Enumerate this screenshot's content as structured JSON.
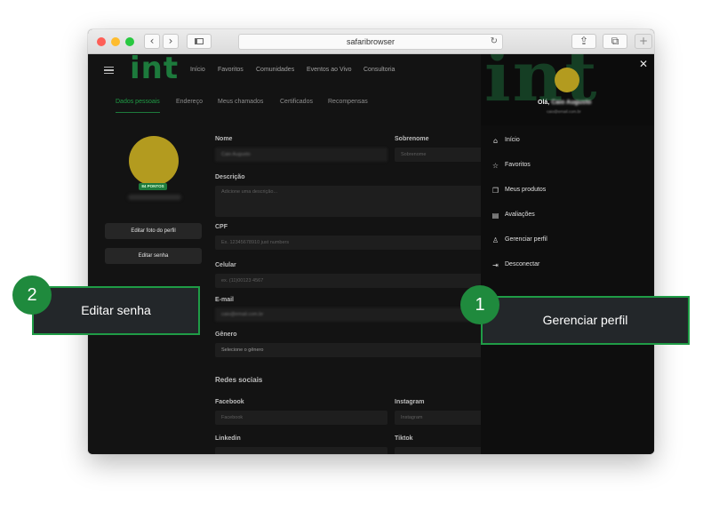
{
  "browser": {
    "url": "safaribrowser",
    "reload_icon": "reload-icon",
    "back_icon": "chevron-left-icon",
    "forward_icon": "chevron-right-icon",
    "sidebar_icon": "sidebar-icon",
    "share_icon": "share-icon",
    "tabs_icon": "tabs-icon",
    "new_tab_icon": "plus-icon",
    "traffic_lights": [
      "#fe5f57",
      "#febc2e",
      "#28c840"
    ]
  },
  "app": {
    "logo": "int",
    "nav": [
      "Início",
      "Favoritos",
      "Comunidades",
      "Eventos ao Vivo",
      "Consultoria"
    ],
    "tabs": [
      "Dados pessoais",
      "Endereço",
      "Meus chamados",
      "Certificados",
      "Recompensas"
    ],
    "active_tab": "Dados pessoais",
    "brand_color": "#1d7a3c"
  },
  "profile": {
    "points": "84 PONTOS",
    "edit_photo_label": "Editar foto do perfil",
    "edit_password_label": "Editar senha"
  },
  "form": {
    "nome_label": "Nome",
    "nome_value": "Caio Augusto",
    "sobrenome_label": "Sobrenome",
    "sobrenome_placeholder": "Sobrenome",
    "descricao_label": "Descrição",
    "descricao_placeholder": "Adicione uma descrição...",
    "cpf_label": "CPF",
    "cpf_placeholder": "Ex. 12345678910 just numbers",
    "celular_label": "Celular",
    "celular_placeholder": "ex. (11)00123 4567",
    "email_label": "E-mail",
    "email_value": "caio@email.com.br",
    "genero_label": "Gênero",
    "genero_value": "Selecione o gênero",
    "redes_title": "Redes sociais",
    "facebook_label": "Facebook",
    "facebook_placeholder": "Facebook",
    "instagram_label": "Instagram",
    "instagram_placeholder": "Instagram",
    "linkedin_label": "Linkedin",
    "tiktok_label": "Tiktok"
  },
  "menu": {
    "greeting": "Olá,",
    "user_name": "Caio Augusto",
    "user_email": "caio@email.com.br",
    "close_icon": "close-icon",
    "items": [
      {
        "label": "Início",
        "icon": "home-icon"
      },
      {
        "label": "Favoritos",
        "icon": "star-icon"
      },
      {
        "label": "Meus produtos",
        "icon": "copy-icon"
      },
      {
        "label": "Avaliações",
        "icon": "book-icon"
      },
      {
        "label": "Gerenciar perfil",
        "icon": "user-icon"
      },
      {
        "label": "Desconectar",
        "icon": "logout-icon"
      }
    ]
  },
  "callouts": [
    {
      "number": "1",
      "label": "Gerenciar perfil"
    },
    {
      "number": "2",
      "label": "Editar senha"
    }
  ]
}
